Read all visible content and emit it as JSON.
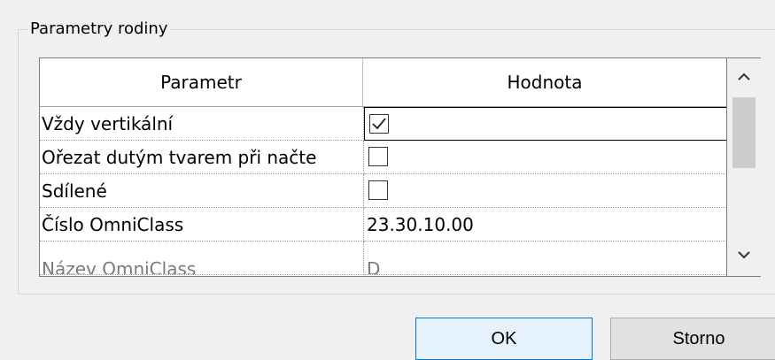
{
  "dialog": {
    "group_label": "Parametry rodiny"
  },
  "grid": {
    "columns": [
      "Parametr",
      "Hodnota"
    ],
    "rows": [
      {
        "name": "Vždy vertikální",
        "type": "checkbox",
        "checked": true
      },
      {
        "name": "Ořezat dutým tvarem při načte",
        "type": "checkbox",
        "checked": false
      },
      {
        "name": "Sdílené",
        "type": "checkbox",
        "checked": false
      },
      {
        "name": "Číslo OmniClass",
        "type": "text",
        "value": "23.30.10.00"
      },
      {
        "name": "Název OmniClass",
        "type": "text",
        "value": "D"
      }
    ]
  },
  "buttons": {
    "ok": "OK",
    "cancel": "Storno"
  },
  "icons": {
    "scroll_up": "chevron-up-icon",
    "scroll_down": "chevron-down-icon",
    "check": "checkmark-icon"
  }
}
